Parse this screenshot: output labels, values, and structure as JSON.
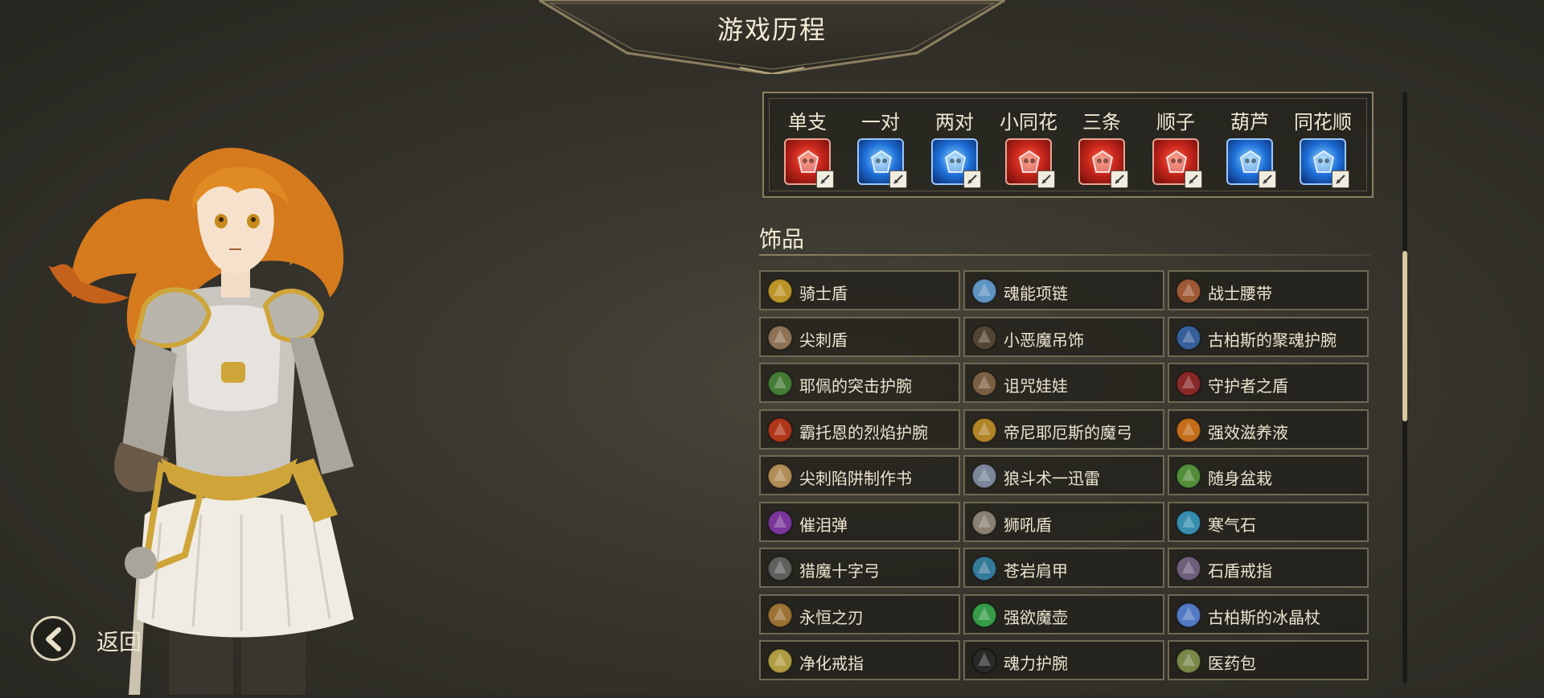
{
  "header": {
    "title": "游戏历程"
  },
  "back": {
    "label": "返回"
  },
  "hands": [
    {
      "label": "单支",
      "icon": "skull-flame-icon",
      "color": "red",
      "badge": "sword-badge-icon"
    },
    {
      "label": "一对",
      "icon": "blue-shield-icon",
      "color": "blue",
      "badge": "shield-badge-icon"
    },
    {
      "label": "两对",
      "icon": "lion-crest-icon",
      "color": "blue",
      "badge": "shield-badge-icon"
    },
    {
      "label": "小同花",
      "icon": "sword-slash-icon",
      "color": "red",
      "badge": "sword-badge-icon"
    },
    {
      "label": "三条",
      "icon": "skull-flame-icon",
      "color": "red",
      "badge": "sword-badge-icon"
    },
    {
      "label": "顺子",
      "icon": "claw-strike-icon",
      "color": "red",
      "badge": "sword-badge-icon"
    },
    {
      "label": "葫芦",
      "icon": "blue-tower-icon",
      "color": "blue",
      "badge": "shield-badge-icon"
    },
    {
      "label": "同花顺",
      "icon": "dragon-strike-icon",
      "color": "blue",
      "badge": "sword-badge-icon"
    }
  ],
  "section": {
    "title": "饰品"
  },
  "items": [
    {
      "label": "骑士盾",
      "icon": "knight-shield-icon",
      "color": "#d4a82a"
    },
    {
      "label": "魂能项链",
      "icon": "soul-necklace-icon",
      "color": "#6aa8e0"
    },
    {
      "label": "战士腰带",
      "icon": "warrior-belt-icon",
      "color": "#b5643a"
    },
    {
      "label": "尖刺盾",
      "icon": "spiked-shield-icon",
      "color": "#a08060"
    },
    {
      "label": "小恶魔吊饰",
      "icon": "imp-charm-icon",
      "color": "#5a4a3a"
    },
    {
      "label": "古柏斯的聚魂护腕",
      "icon": "soul-bracer-icon",
      "color": "#3a6ab0"
    },
    {
      "label": "耶佩的突击护腕",
      "icon": "assault-bracer-icon",
      "color": "#4a8a3a"
    },
    {
      "label": "诅咒娃娃",
      "icon": "cursed-doll-icon",
      "color": "#8a6a4a"
    },
    {
      "label": "守护者之盾",
      "icon": "guardian-shield-icon",
      "color": "#9a2a2a"
    },
    {
      "label": "霸托恩的烈焰护腕",
      "icon": "flame-bracer-icon",
      "color": "#c83a1a"
    },
    {
      "label": "帝尼耶厄斯的魔弓",
      "icon": "magic-bow-icon",
      "color": "#c8962a"
    },
    {
      "label": "强效滋养液",
      "icon": "potion-icon",
      "color": "#e07a1a"
    },
    {
      "label": "尖刺陷阱制作书",
      "icon": "trap-book-icon",
      "color": "#c8a060"
    },
    {
      "label": "狼斗术一迅雷",
      "icon": "tome-icon",
      "color": "#8a9ab0"
    },
    {
      "label": "随身盆栽",
      "icon": "potted-plant-icon",
      "color": "#5aa040"
    },
    {
      "label": "催泪弹",
      "icon": "tear-bomb-icon",
      "color": "#8a3ab0"
    },
    {
      "label": "狮吼盾",
      "icon": "lion-shield-icon",
      "color": "#9a9080"
    },
    {
      "label": "寒气石",
      "icon": "frost-stone-icon",
      "color": "#3aa0c8"
    },
    {
      "label": "猎魔十字弓",
      "icon": "crossbow-icon",
      "color": "#6a6a6a"
    },
    {
      "label": "苍岩肩甲",
      "icon": "pauldron-icon",
      "color": "#3a8ab0"
    },
    {
      "label": "石盾戒指",
      "icon": "stone-ring-icon",
      "color": "#7a6a8a"
    },
    {
      "label": "永恒之刃",
      "icon": "eternal-blade-icon",
      "color": "#b0803a"
    },
    {
      "label": "强欲魔壶",
      "icon": "greed-pot-icon",
      "color": "#3ab050"
    },
    {
      "label": "古柏斯的冰晶杖",
      "icon": "ice-staff-icon",
      "color": "#5a8ae0"
    },
    {
      "label": "净化戒指",
      "icon": "purify-ring-icon",
      "color": "#c8b048"
    },
    {
      "label": "魂力护腕",
      "icon": "soul-power-bracer-icon",
      "color": "#2a2a2a"
    },
    {
      "label": "医药包",
      "icon": "medkit-icon",
      "color": "#8a9a50"
    }
  ]
}
